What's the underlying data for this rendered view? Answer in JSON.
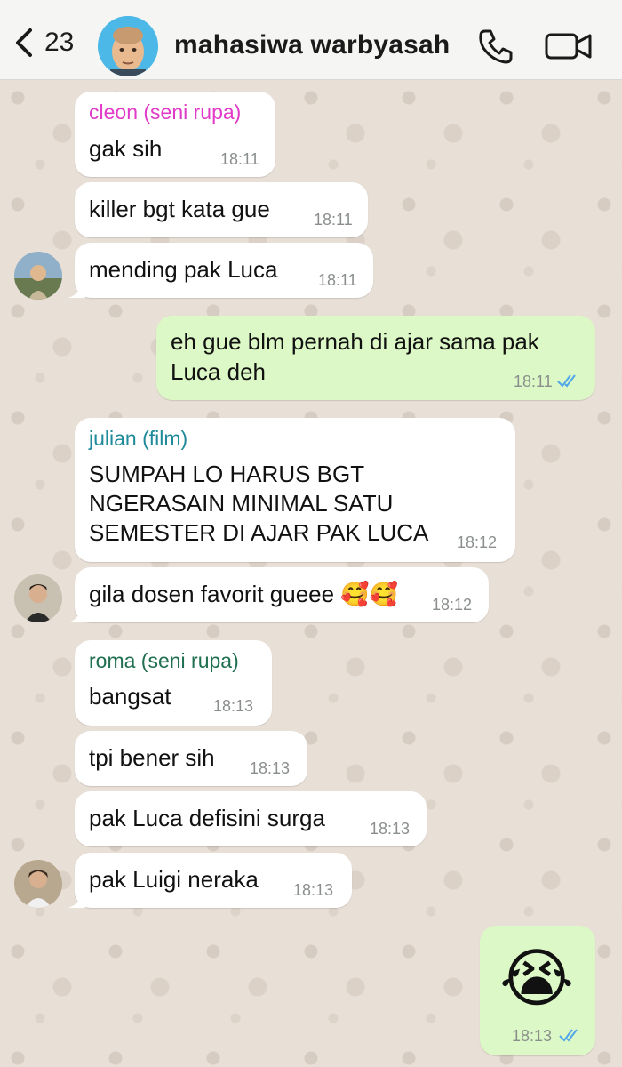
{
  "header": {
    "back_count": "23",
    "title": "mahasiwa warbyasah"
  },
  "messages": [
    {
      "sender": "cleon (seni rupa)",
      "sender_color": "#e13ac8",
      "text": "gak sih",
      "time": "18:11"
    },
    {
      "text": "killer bgt kata gue",
      "time": "18:11"
    },
    {
      "text": "mending pak Luca",
      "time": "18:11"
    },
    {
      "text_lines": [
        "eh gue blm pernah di ajar sama pak",
        "Luca deh"
      ],
      "time": "18:11"
    },
    {
      "sender": "julian (film)",
      "sender_color": "#1e8a9a",
      "text_lines": [
        "SUMPAH LO HARUS BGT",
        "NGERASAIN MINIMAL SATU",
        "SEMESTER DI AJAR PAK LUCA"
      ],
      "time": "18:12"
    },
    {
      "text": "gila dosen favorit gueee 🥰🥰",
      "time": "18:12"
    },
    {
      "sender": "roma (seni rupa)",
      "sender_color": "#1f6f50",
      "text": "bangsat",
      "time": "18:13"
    },
    {
      "text": "tpi bener sih",
      "time": "18:13"
    },
    {
      "text": "pak Luca defisini surga",
      "time": "18:13"
    },
    {
      "text": "pak Luigi neraka",
      "time": "18:13"
    },
    {
      "text": "😭",
      "time": "18:13"
    }
  ],
  "colors": {
    "incoming_bubble": "#ffffff",
    "outgoing_bubble": "#dcf8c6",
    "read_ticks": "#4fa6e8"
  }
}
